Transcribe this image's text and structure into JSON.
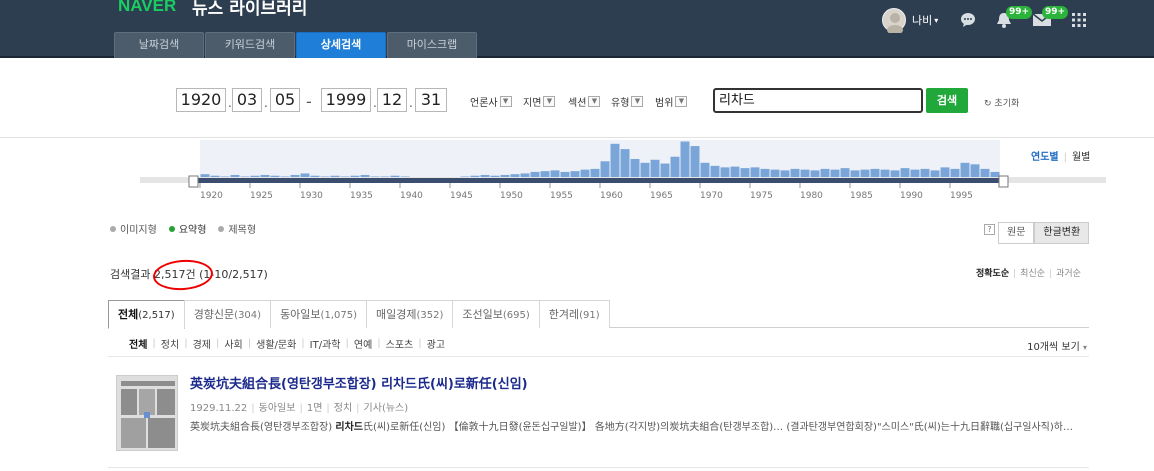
{
  "header": {
    "brand": "NAVER",
    "service": "뉴스 라이브러리",
    "tabs": [
      {
        "label": "날짜검색",
        "active": false
      },
      {
        "label": "키워드검색",
        "active": false
      },
      {
        "label": "상세검색",
        "active": true
      },
      {
        "label": "마이스크랩",
        "active": false
      }
    ],
    "user": {
      "name": "나비",
      "caret": "▾"
    },
    "notification_badge": "99+",
    "mail_badge": "99+"
  },
  "search": {
    "start": {
      "year": "1920",
      "month": "03",
      "day": "05"
    },
    "end": {
      "year": "1999",
      "month": "12",
      "day": "31"
    },
    "filters": [
      "언론사",
      "지면",
      "섹션",
      "유형",
      "범위"
    ],
    "query": "리차드",
    "button": "검색",
    "reset": "초기화"
  },
  "timeline": {
    "view_options": [
      "연도별",
      "월별"
    ],
    "active_view": "연도별",
    "year_labels": [
      "1920",
      "1925",
      "1930",
      "1935",
      "1940",
      "1945",
      "1950",
      "1955",
      "1960",
      "1965",
      "1970",
      "1975",
      "1980",
      "1985",
      "1990",
      "1995"
    ]
  },
  "chart_data": {
    "type": "bar",
    "title": "",
    "x": [
      1920,
      1921,
      1922,
      1923,
      1924,
      1925,
      1926,
      1927,
      1928,
      1929,
      1930,
      1931,
      1932,
      1933,
      1934,
      1935,
      1936,
      1937,
      1938,
      1939,
      1940,
      1941,
      1942,
      1943,
      1944,
      1945,
      1946,
      1947,
      1948,
      1949,
      1950,
      1951,
      1952,
      1953,
      1954,
      1955,
      1956,
      1957,
      1958,
      1959,
      1960,
      1961,
      1962,
      1963,
      1964,
      1965,
      1966,
      1967,
      1968,
      1969,
      1970,
      1971,
      1972,
      1973,
      1974,
      1975,
      1976,
      1977,
      1978,
      1979,
      1980,
      1981,
      1982,
      1983,
      1984,
      1985,
      1986,
      1987,
      1988,
      1989,
      1990,
      1991,
      1992,
      1993,
      1994,
      1995,
      1996,
      1997,
      1998,
      1999
    ],
    "values": [
      5,
      3,
      2,
      4,
      2,
      3,
      4,
      3,
      2,
      4,
      6,
      3,
      2,
      3,
      2,
      3,
      4,
      2,
      2,
      3,
      2,
      1,
      1,
      0,
      0,
      1,
      2,
      3,
      4,
      3,
      4,
      5,
      6,
      8,
      9,
      10,
      8,
      9,
      11,
      12,
      22,
      45,
      38,
      25,
      20,
      24,
      19,
      28,
      48,
      42,
      20,
      16,
      14,
      15,
      13,
      14,
      12,
      11,
      10,
      12,
      11,
      10,
      12,
      11,
      13,
      10,
      11,
      12,
      11,
      10,
      13,
      11,
      12,
      10,
      14,
      12,
      20,
      18,
      12,
      8
    ],
    "ylim": [
      0,
      50
    ]
  },
  "view_mode": {
    "options": [
      "이미지형",
      "요약형",
      "제목형"
    ],
    "active": "요약형",
    "help": "?",
    "convert_buttons": [
      "원문",
      "한글변환"
    ],
    "active_convert": "한글변환"
  },
  "summary": {
    "prefix": "검색결과 ",
    "count": "2,517건",
    "range": " (1-10/2,517)",
    "sorts": [
      "정확도순",
      "최신순",
      "과거순"
    ],
    "active_sort": "정확도순"
  },
  "paper_tabs": [
    {
      "label": "전체",
      "count": "(2,517)",
      "active": true
    },
    {
      "label": "경향신문",
      "count": "(304)",
      "active": false
    },
    {
      "label": "동아일보",
      "count": "(1,075)",
      "active": false
    },
    {
      "label": "매일경제",
      "count": "(352)",
      "active": false
    },
    {
      "label": "조선일보",
      "count": "(695)",
      "active": false
    },
    {
      "label": "한겨레",
      "count": "(91)",
      "active": false
    }
  ],
  "categories": [
    "전체",
    "정치",
    "경제",
    "사회",
    "생활/문화",
    "IT/과학",
    "연예",
    "스포츠",
    "광고"
  ],
  "active_category": "전체",
  "per_page": "10개씩 보기",
  "per_page_caret": "▾",
  "result": {
    "title": "英炭坑夫組合長(영탄갱부조합장) 리차드氏(씨)로新任(신임)",
    "meta": [
      "1929.11.22",
      "동아일보",
      "1면",
      "정치",
      "기사(뉴스)"
    ],
    "body_before": "英炭坑夫組合長(영탄갱부조합장) ",
    "body_highlight": "리차드",
    "body_after": "氏(씨)로新任(신임) 【倫敦十九日發(윤돈십구일발)】 各地方(각지방)의炭坑夫組合(탄갱부조합)… (결과탄갱부연합회장)\"스미스\"氏(씨)는十九日辭職(십구일사직)하…"
  },
  "colors": {
    "header_bg": "#2d3e50",
    "brand_green": "#19ce60",
    "active_tab_blue": "#1f7fd8",
    "search_green": "#20a83b",
    "title_blue": "#1b2a8c",
    "bar_blue": "#7aa5d8",
    "annotation_red": "#e00000"
  },
  "icons": {
    "chat": "chat-bubble-icon",
    "bell": "bell-icon",
    "mail": "mail-icon",
    "apps": "grid-apps-icon",
    "reset": "refresh-icon"
  }
}
